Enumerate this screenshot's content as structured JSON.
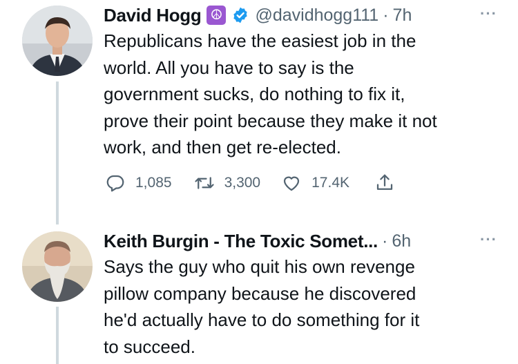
{
  "tweets": [
    {
      "name": "David Hogg",
      "name_emoji": "☮",
      "handle": "@davidhogg111",
      "separator": "·",
      "time": "7h",
      "more": "···",
      "text": "Republicans have the easiest job in the\nworld. All you have to say is the\ngovernment sucks, do nothing to fix it,\nprove their point because they make it not\nwork, and then get re-elected.",
      "actions": {
        "replies": "1,085",
        "retweets": "3,300",
        "likes": "17.4K"
      }
    },
    {
      "name": "Keith Burgin - The Toxic Somet...",
      "separator": "·",
      "time": "6h",
      "more": "···",
      "text": "Says the guy who quit his own revenge\npillow company because he discovered\nhe'd actually have to do something for it\nto succeed."
    }
  ],
  "colors": {
    "text": "#0f1419",
    "secondary": "#536471",
    "verified": "#1d9bf0",
    "thread_line": "#cfd9de",
    "peace_emoji_bg": "#9a57d1"
  }
}
